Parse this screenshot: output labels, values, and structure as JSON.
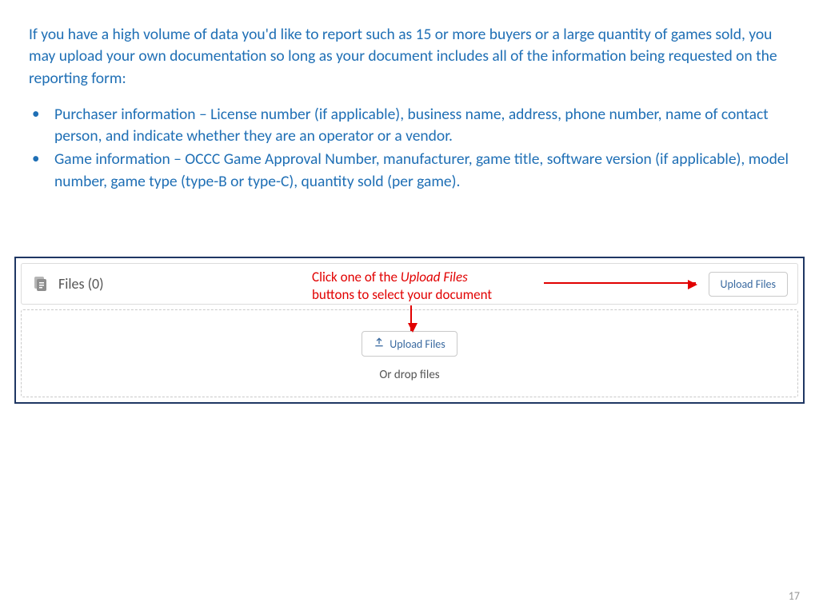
{
  "intro": "If you have a high volume of data you'd like to report such as 15 or more buyers or a large quantity of games sold, you may upload your own documentation so long as your document includes all of the information being requested on the reporting form:",
  "bullets": [
    "Purchaser information – License number (if applicable), business name, address, phone number, name of contact person, and indicate whether they are an operator or a vendor.",
    "Game information – OCCC Game Approval Number, manufacturer, game title, software version (if applicable), model number, game type (type-B or type-C), quantity sold (per game)."
  ],
  "panel": {
    "files_label": "Files (0)",
    "upload_btn_top": "Upload Files",
    "upload_btn_center": "Upload Files",
    "drop_text": "Or drop files"
  },
  "annotation": {
    "line1_a": "Click one of the ",
    "line1_b": "Upload Files",
    "line2": "buttons to select your document"
  },
  "page_number": "17"
}
